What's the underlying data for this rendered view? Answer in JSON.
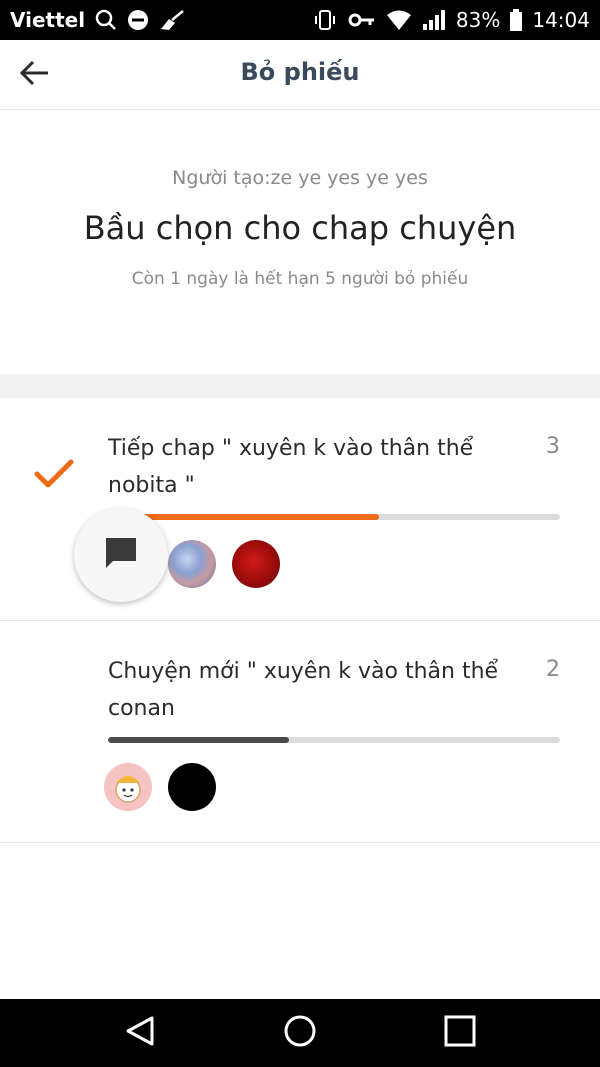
{
  "status_bar": {
    "carrier": "Viettel",
    "battery": "83%",
    "time": "14:04"
  },
  "app_bar": {
    "title": "Bỏ phiếu"
  },
  "poll": {
    "creator": "Người tạo:ze ye yes ye yes",
    "title": "Bầu chọn cho chap chuyện",
    "meta": "Còn 1 ngày là hết hạn 5 người bỏ phiếu"
  },
  "options": [
    {
      "label": "Tiếp chap \" xuyên k vào thân thể nobita \"",
      "votes": "3",
      "fraction": 0.6,
      "selected": true
    },
    {
      "label": "Chuyện mới \" xuyên k vào thân thể conan",
      "votes": "2",
      "fraction": 0.4,
      "selected": false
    }
  ],
  "colors": {
    "accent": "#ef6b17",
    "title": "#3a4a5c",
    "muted": "#8a8a8a",
    "progress_track": "#dcdcdc",
    "progress_fill_unselected": "#4a4a4a"
  },
  "icons": {
    "back": "arrow-left-icon",
    "check": "check-icon",
    "comment": "comment-icon",
    "nav_back": "triangle-back-icon",
    "nav_home": "circle-home-icon",
    "nav_recents": "square-recents-icon"
  }
}
